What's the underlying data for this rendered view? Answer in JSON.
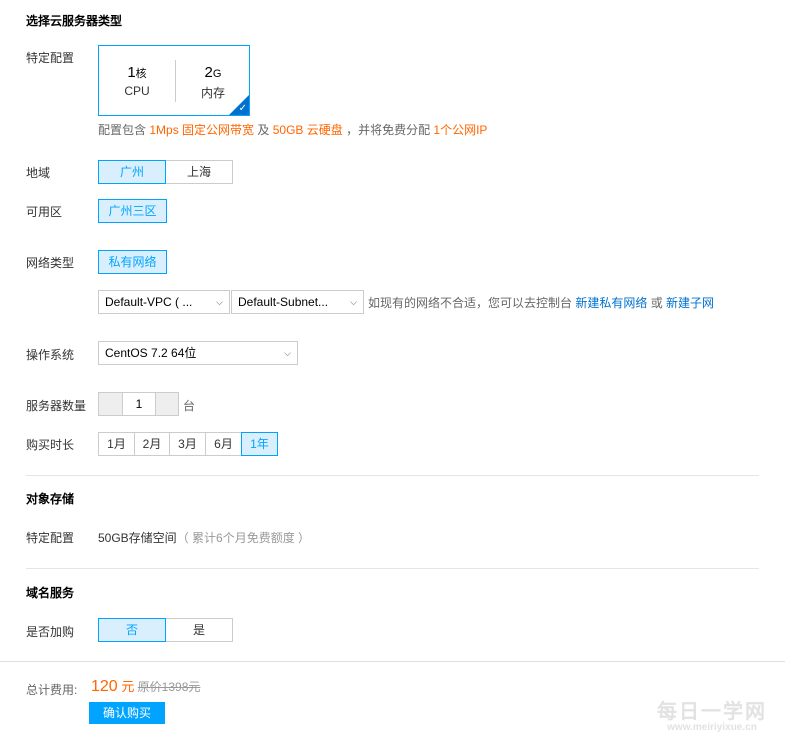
{
  "server_type": {
    "title": "选择云服务器类型",
    "spec_label": "特定配置",
    "cpu": {
      "value": "1",
      "unit_suffix": "核",
      "label": "CPU"
    },
    "memory": {
      "value": "2",
      "unit_suffix": "G",
      "label": "内存"
    },
    "note": {
      "prefix": "配置包含 ",
      "bandwidth": "1Mps",
      "bandwidth_type": "固定公网带宽",
      "and": " 及 ",
      "disk": "50GB 云硬盘",
      "mid": " ，并将免费分配 ",
      "ip": "1个公网IP"
    }
  },
  "region": {
    "label": "地域",
    "options": [
      "广州",
      "上海"
    ],
    "selected": "广州"
  },
  "zone": {
    "label": "可用区",
    "options": [
      "广州三区"
    ],
    "selected": "广州三区"
  },
  "network": {
    "label": "网络类型",
    "options": [
      "私有网络"
    ],
    "selected": "私有网络",
    "vpc_select": "Default-VPC ( ...",
    "subnet_select": "Default-Subnet...",
    "hint": "如现有的网络不合适，您可以去控制台 ",
    "link_vpc": "新建私有网络",
    "or": " 或 ",
    "link_subnet": "新建子网"
  },
  "os": {
    "label": "操作系统",
    "selected": "CentOS 7.2 64位"
  },
  "quantity": {
    "label": "服务器数量",
    "value": "1",
    "unit": "台"
  },
  "duration": {
    "label": "购买时长",
    "options": [
      "1月",
      "2月",
      "3月",
      "6月",
      "1年"
    ],
    "selected": "1年"
  },
  "object_storage": {
    "title": "对象存储",
    "spec_label": "特定配置",
    "value": "50GB存储空间",
    "note": "（ 累计6个月免费额度 ）"
  },
  "domain": {
    "title": "域名服务",
    "label": "是否加购",
    "options": [
      "否",
      "是"
    ],
    "selected": "否"
  },
  "footer": {
    "total_label": "总计费用:",
    "price": "120",
    "currency": " 元",
    "original": "原价1398元",
    "buy_button": "确认购买"
  },
  "watermark": {
    "main": "每日一学网",
    "sub": "www.meiriyixue.cn"
  },
  "colors": {
    "accent": "#00a4ff",
    "selected_bg": "#d9effd",
    "orange": "#ff6600",
    "link": "#0071ce"
  }
}
